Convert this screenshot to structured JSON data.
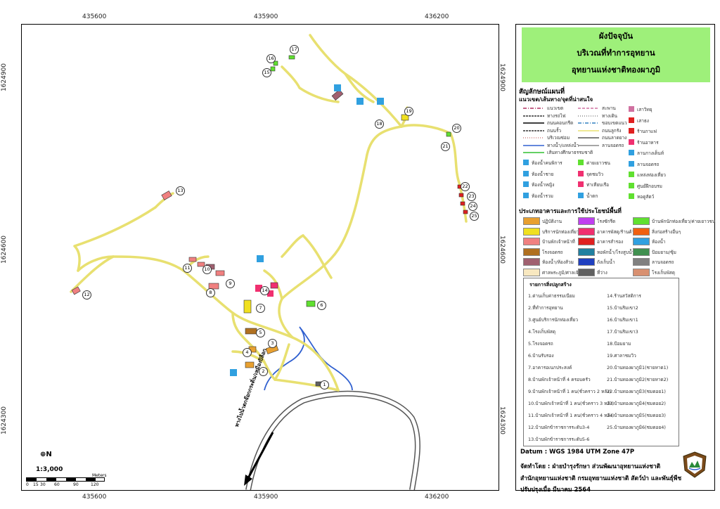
{
  "coords": {
    "top": [
      "435600",
      "435900",
      "436200"
    ],
    "bottom": [
      "435600",
      "435900",
      "436200"
    ],
    "left": [
      "1624900",
      "1624600",
      "1624300"
    ],
    "right": [
      "1624900",
      "1624600",
      "1624300"
    ]
  },
  "title": {
    "line1": "ผังปัจจุบัน",
    "line2": "บริเวณที่ทำการอุทยาน",
    "line3": "อุทยานแห่งชาติทองผาภูมิ"
  },
  "legend": {
    "heading": "สัญลักษณ์แผนที่",
    "subheading": "แนวเขต/เส้นทาง/จุดที่น่าสนใจ",
    "lines": [
      {
        "label": "แนวเขต",
        "color": "#b03060",
        "style": "dashdot"
      },
      {
        "label": "ทางรถไฟ",
        "color": "#333333",
        "style": "rail"
      },
      {
        "label": "ถนนคอนกรีต",
        "color": "#000000",
        "style": "solid"
      },
      {
        "label": "ถนนรั้ว",
        "color": "#333333",
        "style": "fence"
      },
      {
        "label": "บริเวณซ่อม",
        "color": "#d08080",
        "style": "dots"
      },
      {
        "label": "ทางน้ำ/แหล่งน้ำ",
        "color": "#3060d0",
        "style": "solid"
      },
      {
        "label": "เส้นทางศึกษาธรรมชาติ",
        "color": "#30c030",
        "style": "solid"
      }
    ],
    "lines2": [
      {
        "label": "สะพาน",
        "color": "#d070a0",
        "style": "dash"
      },
      {
        "label": "ทางเดิน",
        "color": "#888888",
        "style": "dots"
      },
      {
        "label": "ขอบเขตแนว",
        "color": "#3080c0",
        "style": "dashdot"
      },
      {
        "label": "ถนนลูกรัง",
        "color": "#e8e070",
        "style": "solid"
      },
      {
        "label": "ถนนลาดยาง",
        "color": "#555555",
        "style": "solid"
      },
      {
        "label": "ลานจอดรถ",
        "color": "#888888",
        "style": "solid"
      }
    ],
    "points3": [
      "เสาวิทยุ",
      "เสาธง",
      "ร้านกาแฟ",
      "ร้านอาหาร",
      "ลานกางเต็นท์",
      "ลานจอดรถ",
      "แหล่งท่องเที่ยว",
      "ศูนย์ฝึกอบรม",
      "หอดูสัตว์"
    ],
    "points1": [
      "ห้องน้ำคนพิการ",
      "ห้องน้ำชาย",
      "ห้องน้ำหญิง",
      "ห้องน้ำรวม"
    ],
    "points2": [
      "ค่ายเยาวชน",
      "จุดชมวิว",
      "ท่าเทียบเรือ",
      "น้ำตก"
    ],
    "building_heading": "ประเภทอาคารและการใช้ประโยชน์พื้นที่",
    "swatches": [
      {
        "label": "ปฏิบัติงาน",
        "color": "#e8a030"
      },
      {
        "label": "บริการนักท่องเที่ยว",
        "color": "#f0e020"
      },
      {
        "label": "บ้านพักเจ้าหน้าที่",
        "color": "#f08080"
      },
      {
        "label": "โรงจอดรถ",
        "color": "#b07020"
      },
      {
        "label": "ห้องน้ำ/ห้องส้วม",
        "color": "#a06070"
      },
      {
        "label": "ศาลพระภูมิ/ศาลเจ้าที่",
        "color": "#f8e8c0"
      },
      {
        "label": "โรงซักรีด",
        "color": "#c040f0"
      },
      {
        "label": "อาคารพัสดุ/ร้านค้า",
        "color": "#f03070"
      },
      {
        "label": "อาคารสำรอง",
        "color": "#e02020"
      },
      {
        "label": "หอพักน้ำ/โรงสูบน้ำ",
        "color": "#2080a0"
      },
      {
        "label": "ถังเก็บน้ำ",
        "color": "#2040c0"
      },
      {
        "label": "ที่ว่าง",
        "color": "#606060"
      },
      {
        "label": "บ้านพักนักท่องเที่ยว/ค่ายเยาวชน",
        "color": "#60e030"
      },
      {
        "label": "สิ่งก่อสร้างอื่นๆ",
        "color": "#f06010"
      },
      {
        "label": "ห้องน้ำ",
        "color": "#30a0e0"
      },
      {
        "label": "ป้อมยาม/ซุ้ม",
        "color": "#409050"
      },
      {
        "label": "ลานจอดรถ",
        "color": "#808080"
      },
      {
        "label": "โรงเก็บพัสดุ",
        "color": "#d89070"
      }
    ]
  },
  "building_list": {
    "title": "รายการสิ่งปลูกสร้าง",
    "col1": [
      "1.ด่านเก็บค่าธรรมเนียม",
      "2.ที่ทำการอุทยาน",
      "3.ศูนย์บริการนักท่องเที่ยว",
      "4.โรงเก็บพัสดุ",
      "5.โรงจอดรถ",
      "6.บ้านรับรอง",
      "7.อาคารอเนกประสงค์",
      "8.บ้านพักเจ้าหน้าที่ 4 ครอบครัว",
      "9.บ้านพักเจ้าหน้าที่ 1 คน(ชั่วคราว 2 หลัง)",
      "10.บ้านพักเจ้าหน้าที่ 1 คน(ชั่วคราว 3 หลัง)",
      "11.บ้านพักเจ้าหน้าที่ 1 คน(ชั่วคราว 4 หลัง)",
      "12.บ้านพักข้าราชการระดับ3-4",
      "13.บ้านพักข้าราชการระดับ5-6"
    ],
    "col2": [
      "14.ร้านสวัสดิการ",
      "15.บ้านริมเขา2",
      "16.บ้านริมเขา1",
      "17.บ้านริมเขา3",
      "18.ป้อมยาม",
      "19.ศาลาชมวิว",
      "20.บ้านทองผาภูมิ1(ชายหาด1)",
      "21.บ้านทองผาภูมิ2(ชายหาด2)",
      "22.บ้านทองผาภูมิ3(ชมดอย1)",
      "23.บ้านทองผาภูมิ4(ชมดอย2)",
      "24.บ้านทองผาภูมิ5(ชมดอย3)",
      "25.บ้านทองผาภูมิ6(ชมดอย4)"
    ]
  },
  "footer": {
    "datum": "Datum   : WGS 1984 UTM Zone 47P",
    "made_by1": "จัดทำโดย  : ฝ่ายบำรุงรักษา ส่วนพัฒนาอุทยานแห่งชาติ",
    "made_by2": "สำนักอุทยานแห่งชาติ  กรมอุทยานแห่งชาติ สัตว์ป่า และพันธุ์พืช",
    "updated": "ปรับปรุงเมื่อ มีนาคม 2564"
  },
  "map": {
    "road_label": "ทางไปน้ำตกจ๊อกกระดิ่น/เหมืองปิล็อก",
    "scale_text": "1:3,000",
    "scale_ticks": [
      "0",
      "15",
      "30",
      "60",
      "90",
      "120"
    ],
    "scale_unit": "Meters",
    "north_label": "N",
    "markers": [
      "1",
      "2",
      "3",
      "4",
      "5",
      "6",
      "7",
      "8",
      "9",
      "10",
      "11",
      "12",
      "13",
      "14",
      "15",
      "16",
      "17",
      "18",
      "19",
      "20",
      "21",
      "22",
      "23",
      "24",
      "25"
    ]
  },
  "colors": {
    "title_bg": "#9ef07a",
    "dirt_road": "#e8e070",
    "paved_road": "#555555",
    "water": "#3060d0"
  }
}
